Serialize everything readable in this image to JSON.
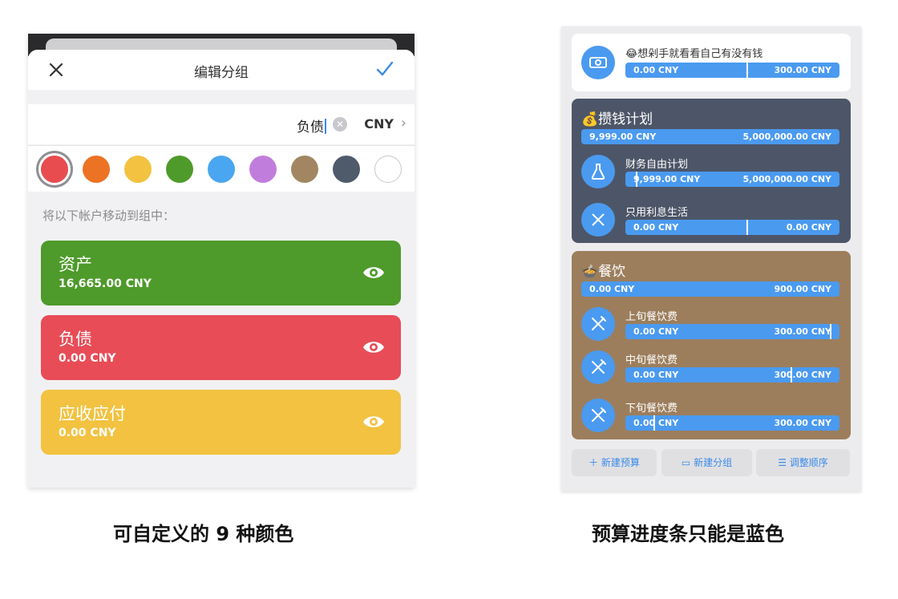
{
  "left": {
    "nav_title": "编辑分组",
    "group_name": "负债",
    "currency": "CNY",
    "swatches": [
      "#e84c4f",
      "#ec7224",
      "#f2c240",
      "#4e9a2a",
      "#4aa6f0",
      "#c17ddc",
      "#a18661",
      "#4f5a6b",
      "#ffffff"
    ],
    "move_hint": "将以下帐户移动到组中：",
    "accounts": [
      {
        "name": "资产",
        "amount": "16,665.00 CNY",
        "color": "#4e9a2a"
      },
      {
        "name": "负债",
        "amount": "0.00 CNY",
        "color": "#e84c57"
      },
      {
        "name": "应收应付",
        "amount": "0.00 CNY",
        "color": "#f2c240"
      }
    ]
  },
  "right": {
    "top_budget": {
      "title": "😂想剁手就看看自己有没有钱",
      "spent": "0.00 CNY",
      "limit": "300.00 CNY"
    },
    "savings": {
      "title": "💰攒钱计划",
      "spent": "9,999.00 CNY",
      "limit": "5,000,000.00 CNY",
      "items": [
        {
          "title": "财务自由计划",
          "spent": "9,999.00 CNY",
          "limit": "5,000,000.00 CNY"
        },
        {
          "title": "只用利息生活",
          "spent": "0.00 CNY",
          "limit": "0.00 CNY"
        }
      ]
    },
    "dining": {
      "title": "🍲餐饮",
      "spent": "0.00 CNY",
      "limit": "900.00 CNY",
      "items": [
        {
          "title": "上旬餐饮费",
          "spent": "0.00 CNY",
          "limit": "300.00 CNY"
        },
        {
          "title": "中旬餐饮费",
          "spent": "0.00 CNY",
          "limit": "300.00 CNY"
        },
        {
          "title": "下旬餐饮费",
          "spent": "0.00 CNY",
          "limit": "300.00 CNY"
        }
      ]
    },
    "buttons": {
      "new_budget": "新建预算",
      "new_group": "新建分组",
      "reorder": "调整顺序"
    }
  },
  "captions": {
    "left": "可自定义的 9 种颜色",
    "right": "预算进度条只能是蓝色"
  }
}
